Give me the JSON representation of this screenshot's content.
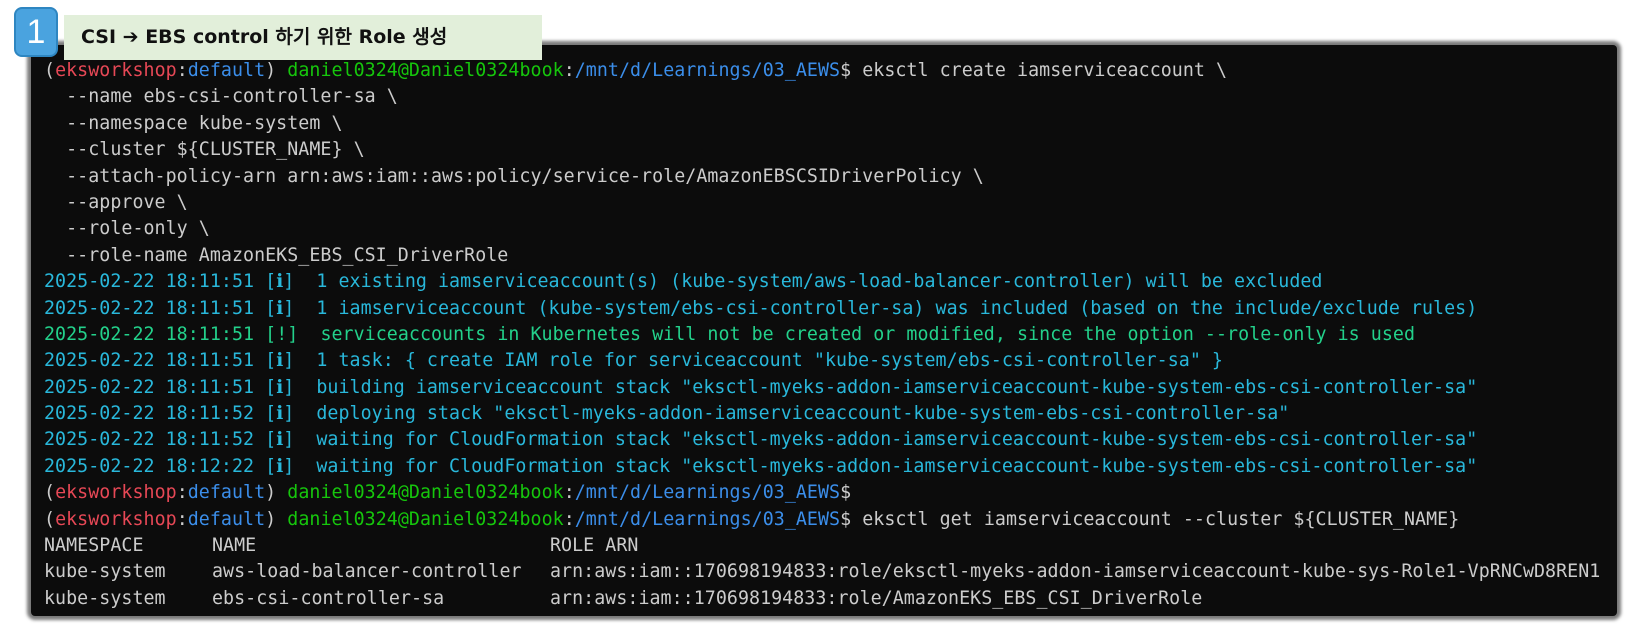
{
  "badge": {
    "number": "1"
  },
  "title": {
    "text": "CSI ➔ EBS control 하기 위한 Role 생성"
  },
  "colors": {
    "background": "#0c0c0c",
    "text": "#cccccc",
    "env": "#e74856",
    "path": "#3b8eea",
    "user": "#16c60c",
    "info": "#29b8db",
    "warn": "#23d18b",
    "title_bg": "#e2efda",
    "badge_bg": "#4aa3df"
  },
  "prompt": {
    "env_name": "eksworkshop",
    "context": "default",
    "user_host": "daniel0324@Daniel0324book",
    "path": "/mnt/d/Learnings/03_AEWS",
    "symbol": "$"
  },
  "terminal": {
    "cmd1": "eksctl create iamserviceaccount \\",
    "cmd1_args": [
      "  --name ebs-csi-controller-sa \\",
      "  --namespace kube-system \\",
      "  --cluster ${CLUSTER_NAME} \\",
      "  --attach-policy-arn arn:aws:iam::aws:policy/service-role/AmazonEBSCSIDriverPolicy \\",
      "  --approve \\",
      "  --role-only \\",
      "  --role-name AmazonEKS_EBS_CSI_DriverRole"
    ],
    "logs": [
      {
        "time": "2025-02-22 18:11:51",
        "level": "[ℹ]",
        "msg": "1 existing iamserviceaccount(s) (kube-system/aws-load-balancer-controller) will be excluded"
      },
      {
        "time": "2025-02-22 18:11:51",
        "level": "[ℹ]",
        "msg": "1 iamserviceaccount (kube-system/ebs-csi-controller-sa) was included (based on the include/exclude rules)"
      },
      {
        "time": "2025-02-22 18:11:51",
        "level": "[!]",
        "msg": "serviceaccounts in Kubernetes will not be created or modified, since the option --role-only is used"
      },
      {
        "time": "2025-02-22 18:11:51",
        "level": "[ℹ]",
        "msg": "1 task: { create IAM role for serviceaccount \"kube-system/ebs-csi-controller-sa\" }"
      },
      {
        "time": "2025-02-22 18:11:51",
        "level": "[ℹ]",
        "msg": "building iamserviceaccount stack \"eksctl-myeks-addon-iamserviceaccount-kube-system-ebs-csi-controller-sa\""
      },
      {
        "time": "2025-02-22 18:11:52",
        "level": "[ℹ]",
        "msg": "deploying stack \"eksctl-myeks-addon-iamserviceaccount-kube-system-ebs-csi-controller-sa\""
      },
      {
        "time": "2025-02-22 18:11:52",
        "level": "[ℹ]",
        "msg": "waiting for CloudFormation stack \"eksctl-myeks-addon-iamserviceaccount-kube-system-ebs-csi-controller-sa\""
      },
      {
        "time": "2025-02-22 18:12:22",
        "level": "[ℹ]",
        "msg": "waiting for CloudFormation stack \"eksctl-myeks-addon-iamserviceaccount-kube-system-ebs-csi-controller-sa\""
      }
    ],
    "cmd2": "eksctl get iamserviceaccount --cluster ${CLUSTER_NAME}",
    "table": {
      "headers": [
        "NAMESPACE",
        "NAME",
        "ROLE ARN"
      ],
      "rows": [
        [
          "kube-system",
          "aws-load-balancer-controller",
          "arn:aws:iam::170698194833:role/eksctl-myeks-addon-iamserviceaccount-kube-sys-Role1-VpRNCwD8REN1"
        ],
        [
          "kube-system",
          "ebs-csi-controller-sa",
          "arn:aws:iam::170698194833:role/AmazonEKS_EBS_CSI_DriverRole"
        ]
      ]
    }
  }
}
